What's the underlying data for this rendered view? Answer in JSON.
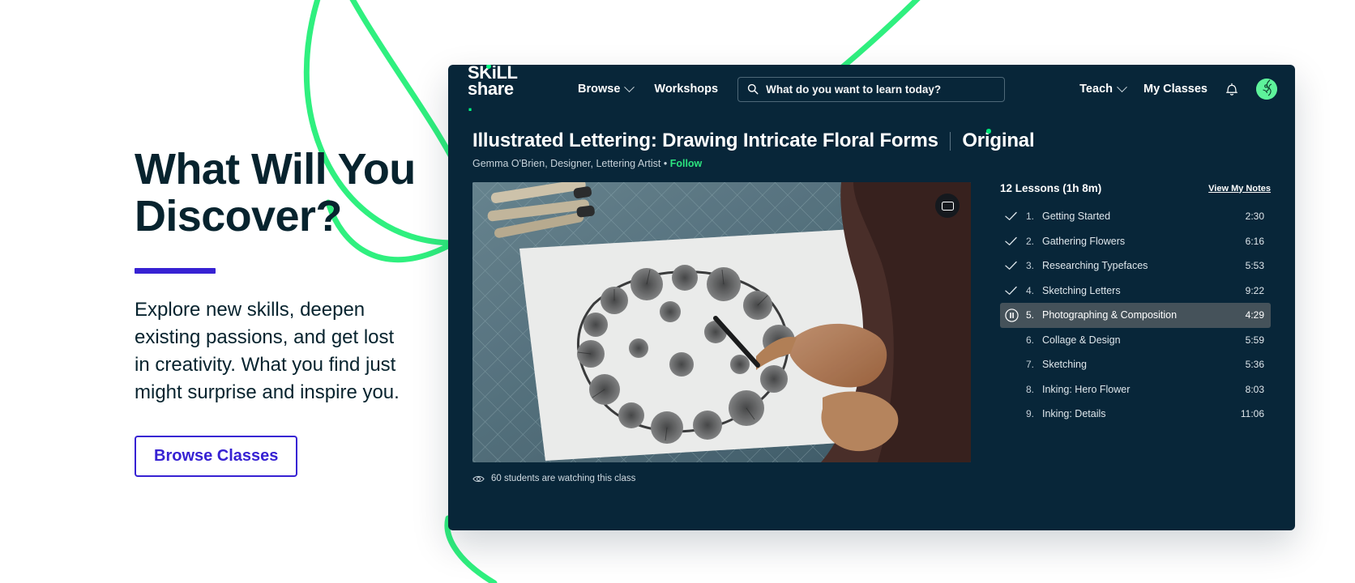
{
  "hero": {
    "title": "What Will You\nDiscover?",
    "body": "Explore new skills, deepen existing passions, and get lost in creativity. What you find just might surprise and inspire you.",
    "button_label": "Browse Classes",
    "rule_color": "#3722d3",
    "accent_color": "#3722d3"
  },
  "decor": {
    "swoosh_color": "#2ff07f"
  },
  "app": {
    "background": "#082639",
    "nav": {
      "logo_line1": "SKiLL",
      "logo_line2": "share",
      "logo_period": ".",
      "links": [
        {
          "label": "Browse",
          "has_chevron": true
        },
        {
          "label": "Workshops",
          "has_chevron": false
        }
      ],
      "search": {
        "icon": "search-icon",
        "placeholder": "What do you want to learn today?"
      },
      "right_links": [
        {
          "label": "Teach",
          "has_chevron": true
        },
        {
          "label": "My Classes",
          "has_chevron": false
        }
      ],
      "bell_icon": "bell-icon",
      "avatar_icon": "avatar-icon"
    },
    "course": {
      "title": "Illustrated Lettering: Drawing Intricate Floral Forms",
      "badge": "Original",
      "author": "Gemma O'Brien, Designer, Lettering Artist",
      "separator": "•",
      "follow_label": "Follow",
      "follow_color": "#2ce47f"
    },
    "player": {
      "pip_icon": "picture-in-picture-icon",
      "eye_icon": "eye-icon",
      "watching_text": "60 students are watching this class"
    },
    "lessons_panel": {
      "count_label": "12 Lessons (1h 8m)",
      "notes_label": "View My Notes",
      "items": [
        {
          "num": "1.",
          "name": "Getting Started",
          "time": "2:30",
          "state": "complete"
        },
        {
          "num": "2.",
          "name": "Gathering Flowers",
          "time": "6:16",
          "state": "complete"
        },
        {
          "num": "3.",
          "name": "Researching Typefaces",
          "time": "5:53",
          "state": "complete"
        },
        {
          "num": "4.",
          "name": "Sketching Letters",
          "time": "9:22",
          "state": "complete"
        },
        {
          "num": "5.",
          "name": "Photographing & Composition",
          "time": "4:29",
          "state": "playing"
        },
        {
          "num": "6.",
          "name": "Collage & Design",
          "time": "5:59",
          "state": "todo"
        },
        {
          "num": "7.",
          "name": "Sketching",
          "time": "5:36",
          "state": "todo"
        },
        {
          "num": "8.",
          "name": "Inking: Hero Flower",
          "time": "8:03",
          "state": "todo"
        },
        {
          "num": "9.",
          "name": "Inking: Details",
          "time": "11:06",
          "state": "todo"
        }
      ]
    }
  }
}
